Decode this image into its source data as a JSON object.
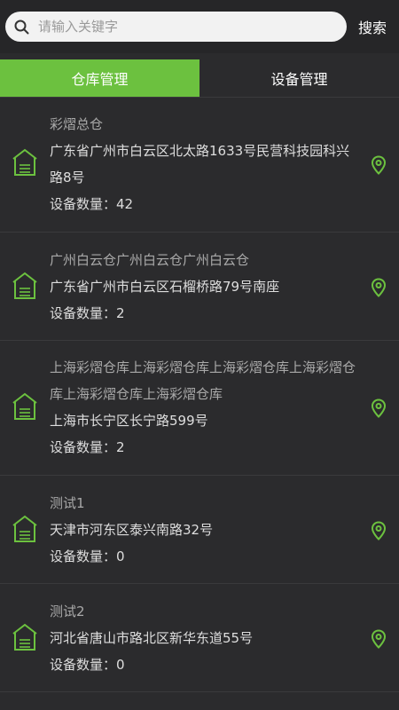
{
  "search": {
    "placeholder": "请输入关键字",
    "button_label": "搜索"
  },
  "tabs": [
    {
      "label": "仓库管理",
      "active": true
    },
    {
      "label": "设备管理",
      "active": false
    }
  ],
  "accent_color": "#6cc13f",
  "warehouses": [
    {
      "name": "彩熠总仓",
      "address": "广东省广州市白云区北太路1633号民营科技园科兴路8号",
      "count_label": "设备数量：",
      "count": "42"
    },
    {
      "name": "广州白云仓广州白云仓广州白云仓",
      "address": "广东省广州市白云区石榴桥路79号南座",
      "count_label": "设备数量：",
      "count": "2"
    },
    {
      "name": "上海彩熠仓库上海彩熠仓库上海彩熠仓库上海彩熠仓库上海彩熠仓库上海彩熠仓库",
      "address": "上海市长宁区长宁路599号",
      "count_label": "设备数量：",
      "count": "2"
    },
    {
      "name": "测试1",
      "address": "天津市河东区泰兴南路32号",
      "count_label": "设备数量：",
      "count": "0"
    },
    {
      "name": "测试2",
      "address": "河北省唐山市路北区新华东道55号",
      "count_label": "设备数量：",
      "count": "0"
    }
  ]
}
